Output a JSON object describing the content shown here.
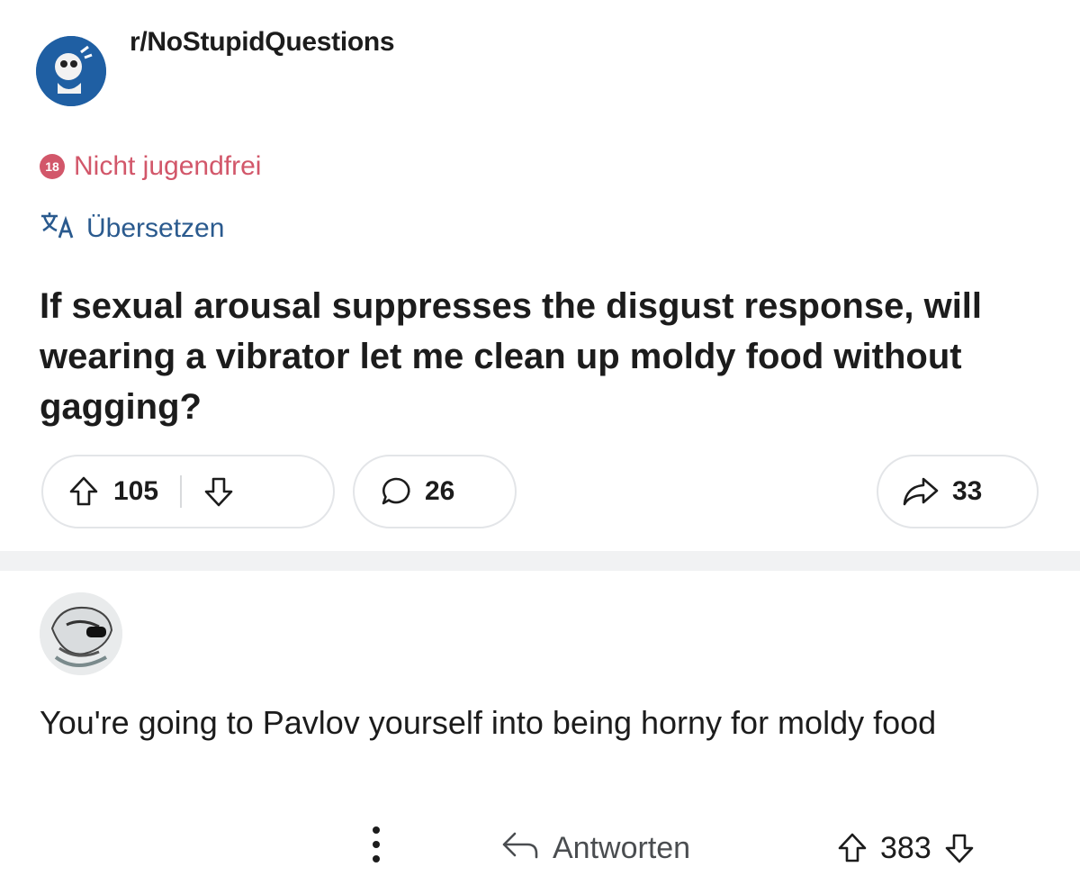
{
  "post": {
    "subreddit": "r/NoStupidQuestions",
    "nsfw_badge": "18",
    "nsfw_label": "Nicht jugendfrei",
    "translate_label": "Übersetzen",
    "title": "If sexual arousal suppresses the disgust response, will wearing a vibrator let me clean up moldy food without gagging?",
    "upvotes": "105",
    "comments": "26",
    "shares": "33"
  },
  "comment": {
    "text": "You're going to Pavlov yourself into being horny for moldy food",
    "reply_label": "Antworten",
    "score": "383"
  },
  "colors": {
    "nsfw": "#d2576a",
    "translate": "#2a5a8e",
    "text": "#1c1c1c",
    "pill_border": "#e3e5e8"
  },
  "icons": [
    "translate-icon",
    "upvote-icon",
    "downvote-icon",
    "comment-icon",
    "share-icon",
    "more-icon",
    "reply-icon"
  ]
}
